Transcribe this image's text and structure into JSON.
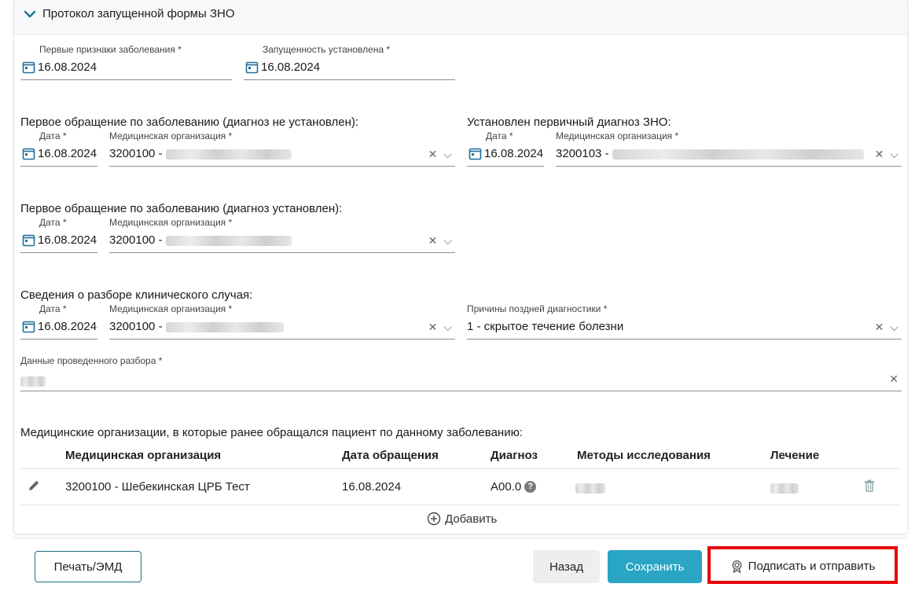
{
  "section": {
    "title": "Протокол запущенной формы ЗНО"
  },
  "fields": {
    "first_signs": {
      "label": "Первые признаки заболевания *",
      "value": "16.08.2024"
    },
    "neglect_set": {
      "label": "Запущенность установлена *",
      "value": "16.08.2024"
    }
  },
  "first_visit_no_dx": {
    "title": "Первое обращение по заболеванию (диагноз не установлен):",
    "date_label": "Дата *",
    "date": "16.08.2024",
    "org_label": "Медицинская организация *",
    "org": "3200100 -"
  },
  "primary_dx": {
    "title": "Установлен первичный диагноз ЗНО:",
    "date_label": "Дата *",
    "date": "16.08.2024",
    "org_label": "Медицинская организация *",
    "org": "3200103 -"
  },
  "first_visit_dx": {
    "title": "Первое обращение по заболеванию (диагноз установлен):",
    "date_label": "Дата *",
    "date": "16.08.2024",
    "org_label": "Медицинская организация *",
    "org": "3200100 -"
  },
  "case_review": {
    "title": "Сведения о разборе клинического случая:",
    "date_label": "Дата *",
    "date": "16.08.2024",
    "org_label": "Медицинская организация *",
    "org": "3200100 -",
    "late_reason_label": "Причины поздней диагностики *",
    "late_reason": "1 - скрытое течение болезни",
    "review_data_label": "Данные проведенного разбора *"
  },
  "orgs_table": {
    "title": "Медицинские организации, в которые ранее обращался пациент по данному заболеванию:",
    "headers": [
      "Медицинская организация",
      "Дата обращения",
      "Диагноз",
      "Методы исследования",
      "Лечение"
    ],
    "rows": [
      {
        "org": "3200100 - Шебекинская ЦРБ Тест",
        "date": "16.08.2024",
        "diagnosis": "A00.0"
      }
    ],
    "add_label": "Добавить"
  },
  "footer": {
    "print_label": "Печать/ЭМД",
    "back_label": "Назад",
    "save_label": "Сохранить",
    "sign_label": "Подписать и отправить"
  },
  "colors": {
    "accent": "#2aa5c3",
    "highlight": "#e8000b",
    "border": "#8e8e8e"
  },
  "icons": [
    "chevron-down-icon",
    "calendar-icon",
    "clear-icon",
    "dropdown-icon",
    "edit-icon",
    "delete-icon",
    "add-circle-icon",
    "help-icon",
    "signature-icon"
  ]
}
